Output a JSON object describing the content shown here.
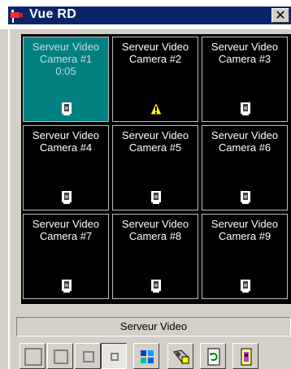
{
  "window": {
    "title": "Vue RD",
    "close_glyph": "✕"
  },
  "icons": {
    "app": "camera-flag-icon",
    "camera": "video-camera-icon",
    "warning": "warning-icon",
    "close": "close-icon"
  },
  "colors": {
    "titlebar": "#0a246a",
    "selected_cell": "#008080",
    "grid": "#000000",
    "window_bg": "#d4d0c8"
  },
  "cameras": [
    {
      "line1": "Serveur Video",
      "line2": "Camera #1",
      "line3": "0:05",
      "selected": true,
      "icon": "video-camera-icon"
    },
    {
      "line1": "Serveur Video",
      "line2": "Camera #2",
      "line3": "",
      "selected": false,
      "icon": "warning-icon"
    },
    {
      "line1": "Serveur Video",
      "line2": "Camera #3",
      "line3": "",
      "selected": false,
      "icon": "video-camera-icon"
    },
    {
      "line1": "Serveur Video",
      "line2": "Camera #4",
      "line3": "",
      "selected": false,
      "icon": "video-camera-icon"
    },
    {
      "line1": "Serveur Video",
      "line2": "Camera #5",
      "line3": "",
      "selected": false,
      "icon": "video-camera-icon"
    },
    {
      "line1": "Serveur Video",
      "line2": "Camera #6",
      "line3": "",
      "selected": false,
      "icon": "video-camera-icon"
    },
    {
      "line1": "Serveur Video",
      "line2": "Camera #7",
      "line3": "",
      "selected": false,
      "icon": "video-camera-icon"
    },
    {
      "line1": "Serveur Video",
      "line2": "Camera #8",
      "line3": "",
      "selected": false,
      "icon": "video-camera-icon"
    },
    {
      "line1": "Serveur Video",
      "line2": "Camera #9",
      "line3": "",
      "selected": false,
      "icon": "video-camera-icon"
    }
  ],
  "status": {
    "text": "Serveur Video"
  },
  "toolbar": {
    "buttons": [
      {
        "name": "layout-1x1-button",
        "icon": "single-square-icon"
      },
      {
        "name": "layout-2x2-button",
        "icon": "square-medium-icon"
      },
      {
        "name": "layout-3x3-button",
        "icon": "square-small-icon"
      },
      {
        "name": "layout-4x4-button",
        "icon": "square-tiny-icon",
        "pressed": true
      },
      {
        "name": "quad-view-button",
        "icon": "quad-color-icon"
      },
      {
        "name": "snapshot-button",
        "icon": "camera-tool-icon"
      },
      {
        "name": "refresh-button",
        "icon": "refresh-icon"
      },
      {
        "name": "exit-button",
        "icon": "door-exit-icon"
      }
    ]
  }
}
